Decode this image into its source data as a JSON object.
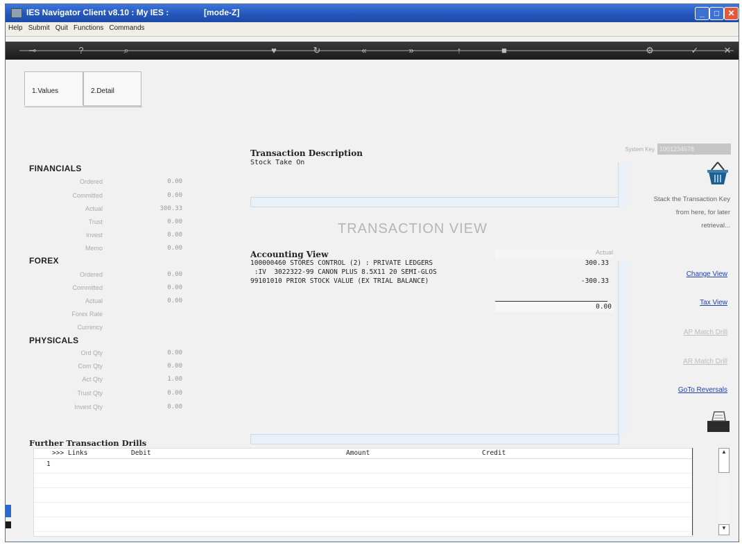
{
  "window": {
    "title": "IES Navigator Client v8.10 : My IES :",
    "mode": "[mode-Z]"
  },
  "menu": [
    "Help",
    "Submit",
    "Quit",
    "Functions",
    "Commands"
  ],
  "toolbar_icons": [
    "exit-icon",
    "help-icon",
    "search-icon",
    "favorite-icon",
    "refresh-icon",
    "prev-icon",
    "next-icon",
    "up-icon",
    "stop-icon",
    "settings-icon",
    "ok-icon",
    "close-icon"
  ],
  "tabs": [
    {
      "label": "1.Values"
    },
    {
      "label": "2.Detail"
    }
  ],
  "system_key": {
    "label": "System Key",
    "value": "1001234578"
  },
  "financials": {
    "title": "FINANCIALS",
    "rows": [
      {
        "label": "Ordered",
        "value": "0.00"
      },
      {
        "label": "Committed",
        "value": "0.00"
      },
      {
        "label": "Actual",
        "value": "300.33"
      },
      {
        "label": "Trust",
        "value": "0.00"
      },
      {
        "label": "Invest",
        "value": "0.00"
      },
      {
        "label": "Memo",
        "value": "0.00"
      }
    ]
  },
  "forex": {
    "title": "FOREX",
    "rows": [
      {
        "label": "Ordered",
        "value": "0.00"
      },
      {
        "label": "Committed",
        "value": "0.00"
      },
      {
        "label": "Actual",
        "value": "0.00"
      },
      {
        "label": "Forex Rate",
        "value": ""
      },
      {
        "label": "Currency",
        "value": ""
      }
    ]
  },
  "physicals": {
    "title": "PHYSICALS",
    "rows": [
      {
        "label": "Ord Qty",
        "value": "0.00"
      },
      {
        "label": "Com Qty",
        "value": "0.00"
      },
      {
        "label": "Act Qty",
        "value": "1.00"
      },
      {
        "label": "Trust Qty",
        "value": "0.00"
      },
      {
        "label": "Invest Qty",
        "value": "0.00"
      }
    ]
  },
  "transaction": {
    "desc_title": "Transaction Description",
    "desc_text": "Stock Take On",
    "view_title": "TRANSACTION VIEW",
    "acct_title": "Accounting View",
    "actual_header": "Actual",
    "lines": [
      "100000460 STORES CONTROL (2) : PRIVATE LEDGERS",
      " :IV  3022322-99 CANON PLUS 8.5X11 20 SEMI-GLOS",
      "99101010 PRIOR STOCK VALUE (EX TRIAL BALANCE)"
    ],
    "amounts": [
      "300.33",
      "",
      "-300.33"
    ],
    "total": "0.00"
  },
  "stack": {
    "text": "Stack the Transaction Key from here, for later retrieval..."
  },
  "links": {
    "change_view": "Change View",
    "tax_view": "Tax View",
    "ap_match": "AP Match Drill",
    "ar_match": "AR Match Drill",
    "goto_reversals": "GoTo Reversals"
  },
  "further": {
    "title": "Further Transaction Drills",
    "columns": [
      ">>> Links",
      "Debit",
      "Amount",
      "Credit"
    ],
    "row_number": "1"
  }
}
